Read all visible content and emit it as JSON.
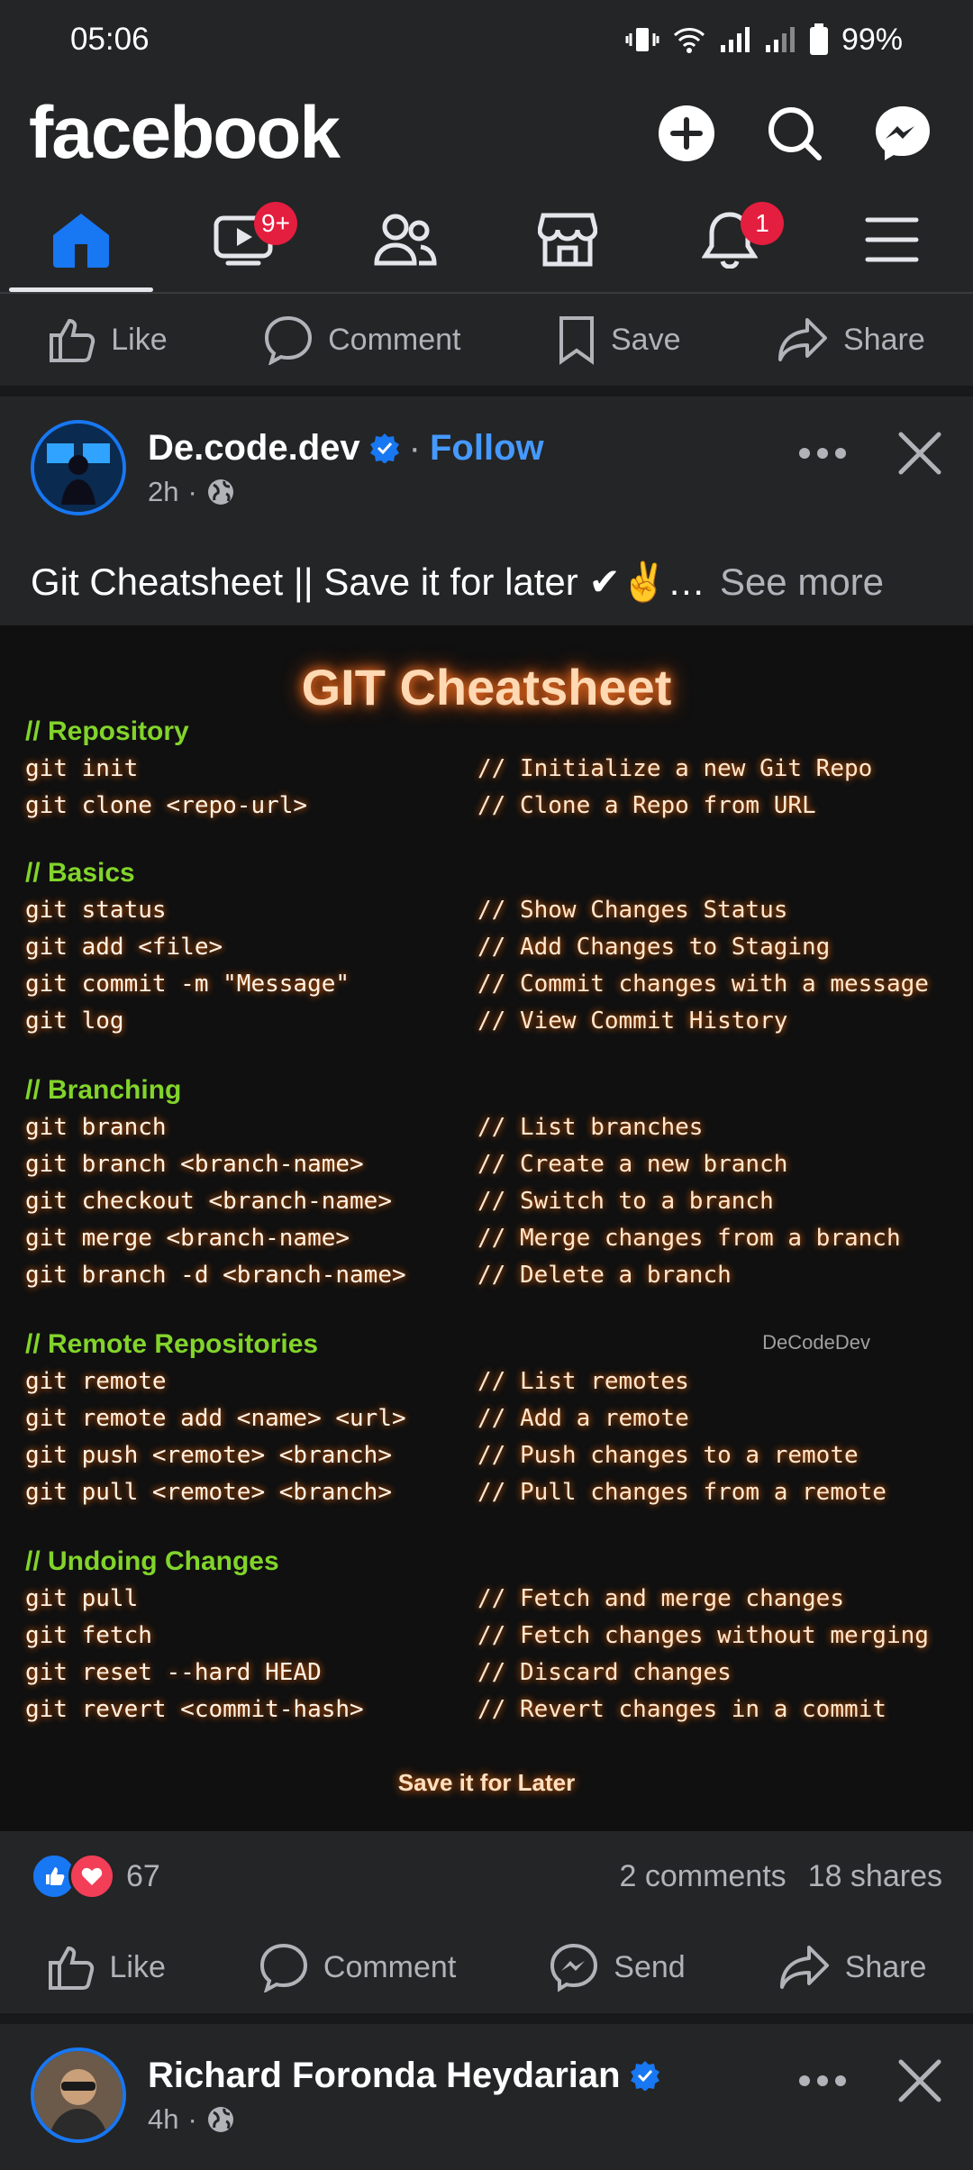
{
  "status_bar": {
    "time": "05:06",
    "battery": "99%"
  },
  "header": {
    "logo": "facebook"
  },
  "tabs": [
    {
      "name": "home",
      "badge": ""
    },
    {
      "name": "video",
      "badge": "9+"
    },
    {
      "name": "friends",
      "badge": ""
    },
    {
      "name": "marketplace",
      "badge": ""
    },
    {
      "name": "notifications",
      "badge": "1"
    },
    {
      "name": "menu",
      "badge": ""
    }
  ],
  "top_actions": {
    "like": "Like",
    "comment": "Comment",
    "save": "Save",
    "share": "Share"
  },
  "post1": {
    "author": "De.code.dev",
    "follow_sep": "·",
    "follow": "Follow",
    "time": "2h",
    "dot": "·",
    "caption": "Git Cheatsheet || Save it for later ✔✌…",
    "see_more": "See more",
    "cheat": {
      "title": "GIT Cheatsheet",
      "watermark": "DeCodeDev",
      "footer": "Save it for Later",
      "sections": [
        {
          "title": "// Repository",
          "rows": [
            {
              "cmd": "git init",
              "cmt": "// Initialize a new Git Repo"
            },
            {
              "cmd": "git clone <repo-url>",
              "cmt": "// Clone a Repo from URL"
            }
          ]
        },
        {
          "title": "// Basics",
          "rows": [
            {
              "cmd": "git status",
              "cmt": "// Show Changes Status"
            },
            {
              "cmd": "git add <file>",
              "cmt": "// Add Changes to Staging"
            },
            {
              "cmd": "git commit -m \"Message\"",
              "cmt": "// Commit changes with a message"
            },
            {
              "cmd": "git log",
              "cmt": "// View Commit History"
            }
          ]
        },
        {
          "title": "// Branching",
          "rows": [
            {
              "cmd": "git branch",
              "cmt": "// List branches"
            },
            {
              "cmd": "git branch <branch-name>",
              "cmt": "// Create a new branch"
            },
            {
              "cmd": "git checkout <branch-name>",
              "cmt": "// Switch to a branch"
            },
            {
              "cmd": "git merge <branch-name>",
              "cmt": "// Merge changes from a branch"
            },
            {
              "cmd": "git branch -d <branch-name>",
              "cmt": "// Delete a branch"
            }
          ]
        },
        {
          "title": "// Remote Repositories",
          "rows": [
            {
              "cmd": "git remote",
              "cmt": "// List remotes"
            },
            {
              "cmd": "git remote add <name> <url>",
              "cmt": "// Add a remote"
            },
            {
              "cmd": "git push <remote> <branch>",
              "cmt": "// Push changes to a remote"
            },
            {
              "cmd": "git pull <remote> <branch>",
              "cmt": "// Pull changes from a remote"
            }
          ]
        },
        {
          "title": "// Undoing Changes",
          "rows": [
            {
              "cmd": "git pull",
              "cmt": "// Fetch and merge changes"
            },
            {
              "cmd": "git fetch",
              "cmt": "// Fetch changes without merging"
            },
            {
              "cmd": "git reset --hard HEAD",
              "cmt": "// Discard changes"
            },
            {
              "cmd": "git revert <commit-hash>",
              "cmt": "// Revert changes in a commit"
            }
          ]
        }
      ]
    },
    "reaction_count": "67",
    "comments": "2 comments",
    "shares": "18 shares",
    "actions": {
      "like": "Like",
      "comment": "Comment",
      "send": "Send",
      "share": "Share"
    }
  },
  "post2": {
    "author": "Richard Foronda Heydarian",
    "time": "4h",
    "dot": "·"
  },
  "colors": {
    "accent": "#1877f2",
    "badge": "#e41e3f",
    "section_green": "#82d42b",
    "glow": "#ff6a00"
  }
}
